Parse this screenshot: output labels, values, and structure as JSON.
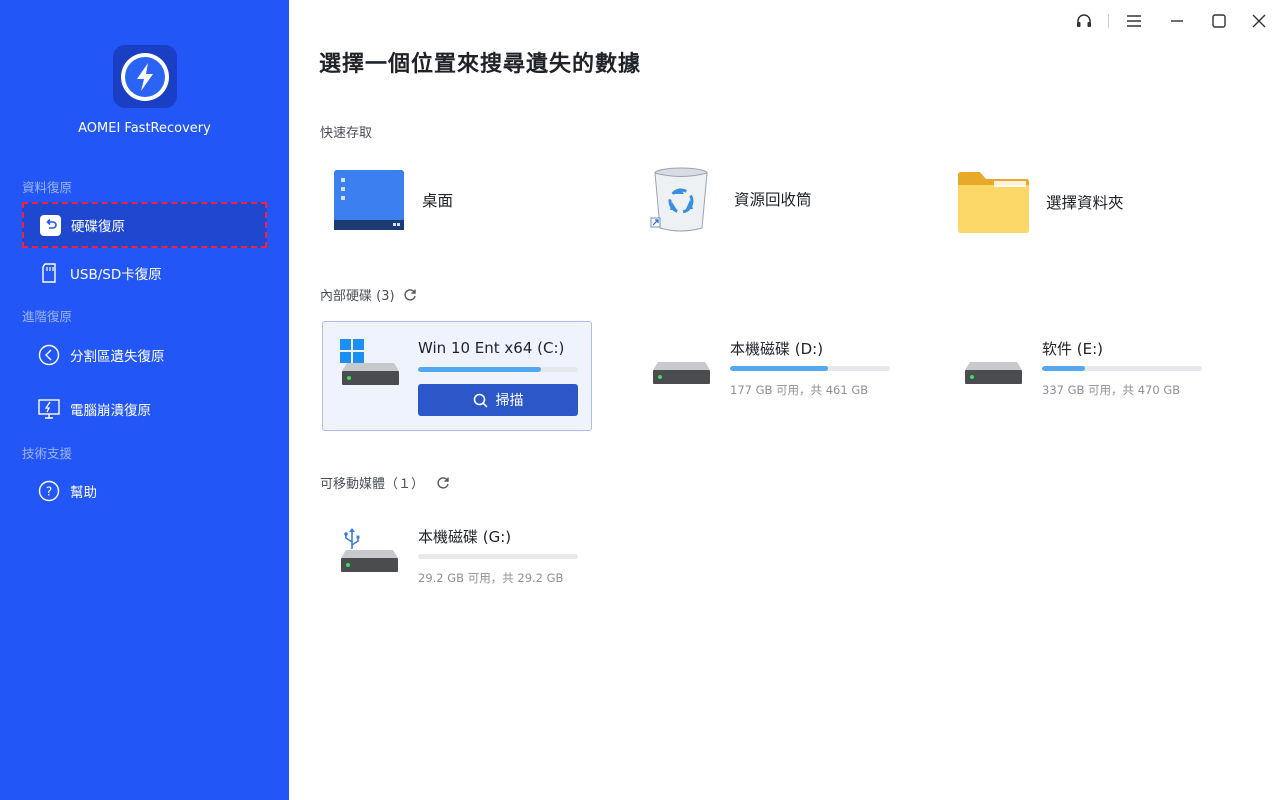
{
  "app": {
    "name": "AOMEI FastRecovery"
  },
  "sidebar": {
    "sections": [
      {
        "label": "資料復原"
      },
      {
        "label": "進階復原"
      },
      {
        "label": "技術支援"
      }
    ],
    "items": [
      {
        "label": "硬碟復原",
        "icon": "disk-restore-icon",
        "active": true
      },
      {
        "label": "USB/SD卡復原",
        "icon": "sd-card-icon"
      },
      {
        "label": "分割區遺失復原",
        "icon": "partition-icon"
      },
      {
        "label": "電腦崩潰復原",
        "icon": "monitor-crash-icon"
      },
      {
        "label": "幫助",
        "icon": "help-icon"
      }
    ]
  },
  "window_controls": [
    "headset-icon",
    "menu-icon",
    "minimize-icon",
    "maximize-icon",
    "close-icon"
  ],
  "main": {
    "title": "選擇一個位置來搜尋遺失的數據",
    "quick_access": {
      "label": "快速存取",
      "items": [
        {
          "label": "桌面",
          "icon": "desktop-icon"
        },
        {
          "label": "資源回收筒",
          "icon": "recycle-bin-icon"
        },
        {
          "label": "選擇資料夾",
          "icon": "folder-icon"
        }
      ]
    },
    "internal": {
      "label": "內部硬碟 (3)",
      "drives": [
        {
          "name": "Win 10 Ent x64 (C:)",
          "usage": 0.77,
          "info": "",
          "selected": true,
          "scan_label": "掃描"
        },
        {
          "name": "本機磁碟 (D:)",
          "usage": 0.61,
          "info": "177 GB 可用，共 461 GB"
        },
        {
          "name": "软件 (E:)",
          "usage": 0.27,
          "info": "337 GB 可用，共 470 GB"
        }
      ]
    },
    "removable": {
      "label": "可移動媒體（１）",
      "drives": [
        {
          "name": "本機磁碟 (G:)",
          "usage": 0.0,
          "info": "29.2 GB 可用，共 29.2 GB"
        }
      ]
    }
  },
  "colors": {
    "sidebar": "#2356f6",
    "accent": "#2b57c9",
    "bar": "#55a8ef",
    "highlight": "#ff1d3a"
  }
}
